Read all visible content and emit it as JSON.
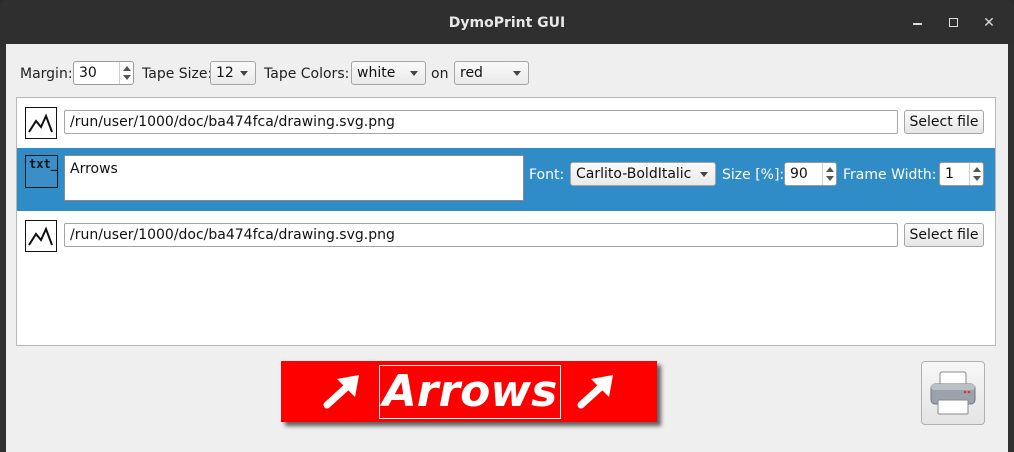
{
  "window": {
    "title": "DymoPrint GUI"
  },
  "toolbar": {
    "margin_label": "Margin:",
    "margin_value": "30",
    "tape_size_label": "Tape Size:",
    "tape_size_value": "12",
    "tape_colors_label": "Tape Colors:",
    "tape_fg_value": "white",
    "on_label": "on",
    "tape_bg_value": "red"
  },
  "rows": [
    {
      "type": "image",
      "path": "/run/user/1000/doc/ba474fca/drawing.svg.png",
      "button": "Select file"
    },
    {
      "type": "text",
      "icon_text": "txt_",
      "text": "Arrows",
      "font_label": "Font:",
      "font_value": "Carlito-BoldItalic",
      "size_label": "Size [%]:",
      "size_value": "90",
      "frame_label": "Frame Width:",
      "frame_value": "1"
    },
    {
      "type": "image",
      "path": "/run/user/1000/doc/ba474fca/drawing.svg.png",
      "button": "Select file"
    }
  ],
  "preview": {
    "text": "Arrows",
    "background": "#ff0000",
    "foreground": "#ffffff"
  },
  "colors": {
    "selection": "#308cc6",
    "titlebar": "#2f2f2f"
  },
  "icons": {
    "image": "picture-icon",
    "text": "text-icon",
    "print": "printer-icon"
  }
}
